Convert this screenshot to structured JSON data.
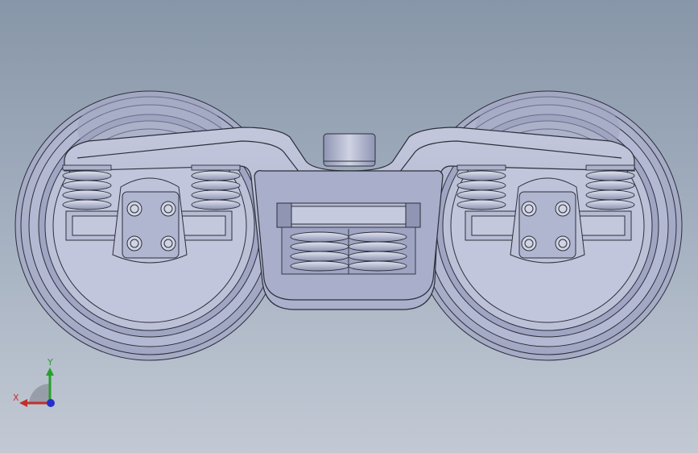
{
  "viewport": {
    "background_top": "#8796a8",
    "background_bottom": "#c2c9d4",
    "model_fill": "#b9bed6",
    "model_shade": "#9da3bf",
    "model_stroke": "#2c2f3a"
  },
  "triad": {
    "x_label": "X",
    "y_label": "Y",
    "x_color": "#c0302a",
    "y_color": "#27a02c",
    "z_color": "#2431c8",
    "icon": "axis-triad-icon"
  }
}
